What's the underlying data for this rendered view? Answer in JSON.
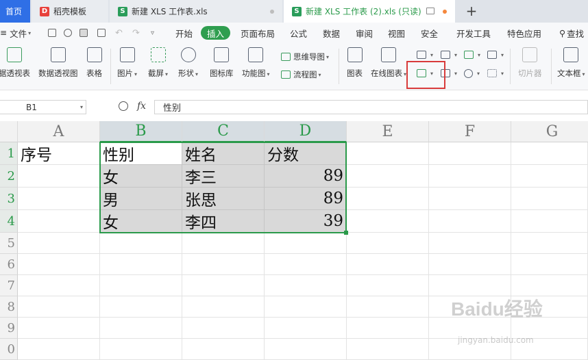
{
  "tabs": {
    "home": "首页",
    "t1": "稻壳模板",
    "t2": "新建 XLS 工作表.xls",
    "t3": "新建 XLS 工作表 (2).xls (只读)",
    "new_tab": "+"
  },
  "menu": {
    "file": "文件",
    "items": [
      "开始",
      "插入",
      "页面布局",
      "公式",
      "数据",
      "审阅",
      "视图",
      "安全",
      "开发工具",
      "特色应用"
    ],
    "search": "查找"
  },
  "ribbon": {
    "pivot_table": "据透视表",
    "pivot_chart": "数据透视图",
    "table": "表格",
    "picture": "图片",
    "screenshot": "截屏",
    "shape": "形状",
    "icon_lib": "图标库",
    "function_chart": "功能图",
    "mindmap": "思维导图",
    "flowchart": "流程图",
    "chart": "图表",
    "online_chart": "在线图表",
    "slicer": "切片器",
    "textbox": "文本框"
  },
  "formula_bar": {
    "name_box": "B1",
    "fx": "fx",
    "value": "性别"
  },
  "grid": {
    "columns": [
      "A",
      "B",
      "C",
      "D",
      "E",
      "F",
      "G"
    ],
    "rows": [
      "1",
      "2",
      "3",
      "4",
      "5",
      "6",
      "7",
      "8",
      "9",
      "0"
    ],
    "cells": {
      "A1": "序号",
      "B1": "性别",
      "C1": "姓名",
      "D1": "分数",
      "B2": "女",
      "C2": "李三",
      "D2": "89",
      "B3": "男",
      "C3": "张思",
      "D3": "89",
      "B4": "女",
      "C4": "李四",
      "D4": "39"
    }
  },
  "watermark": {
    "brand": "Baidu经验",
    "url": "jingyan.baidu.com"
  }
}
